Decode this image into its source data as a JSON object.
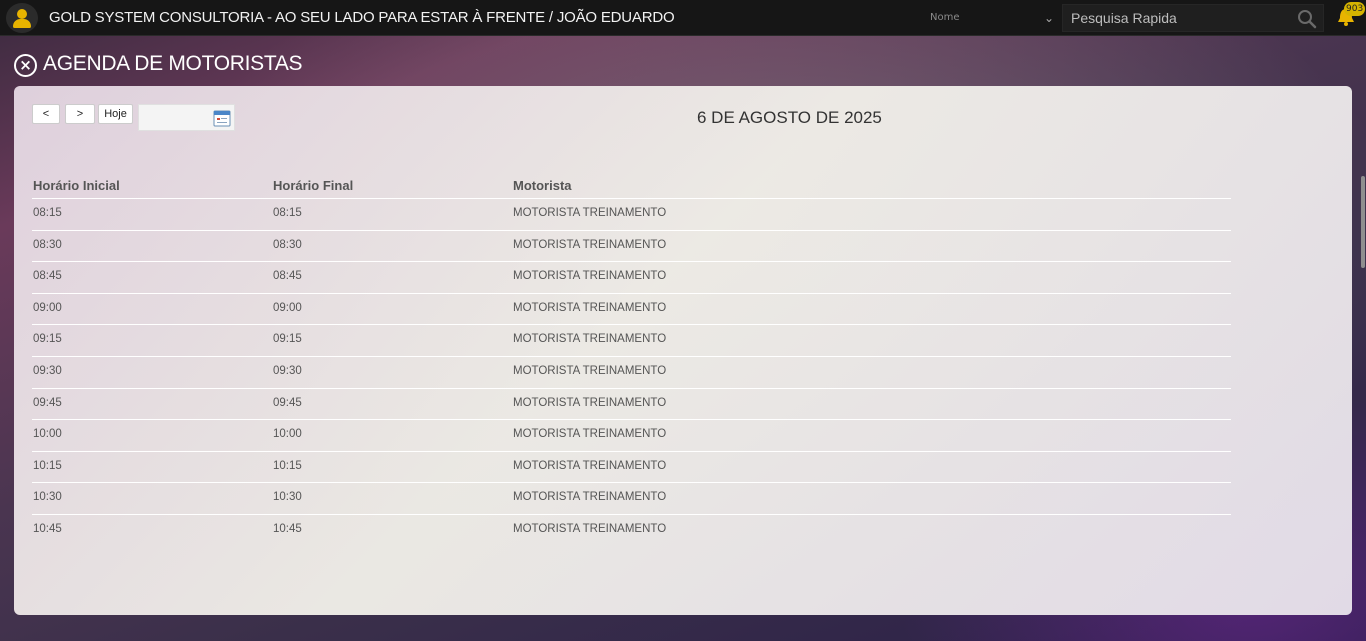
{
  "header": {
    "app_title": "GOLD SYSTEM CONSULTORIA - AO SEU LADO PARA ESTAR À FRENTE / JOÃO EDUARDO",
    "search_field_select": "Nome",
    "search_placeholder": "Pesquisa Rapida",
    "notification_count": "903"
  },
  "page": {
    "title": "AGENDA DE MOTORISTAS"
  },
  "toolbar": {
    "prev_label": "<",
    "next_label": ">",
    "today_label": "Hoje",
    "date_value": "",
    "date_heading": "6 DE AGOSTO DE 2025"
  },
  "table": {
    "columns": [
      "Horário Inicial",
      "Horário Final",
      "Motorista"
    ],
    "rows": [
      [
        "08:15",
        "08:15",
        "MOTORISTA TREINAMENTO"
      ],
      [
        "08:30",
        "08:30",
        "MOTORISTA TREINAMENTO"
      ],
      [
        "08:45",
        "08:45",
        "MOTORISTA TREINAMENTO"
      ],
      [
        "09:00",
        "09:00",
        "MOTORISTA TREINAMENTO"
      ],
      [
        "09:15",
        "09:15",
        "MOTORISTA TREINAMENTO"
      ],
      [
        "09:30",
        "09:30",
        "MOTORISTA TREINAMENTO"
      ],
      [
        "09:45",
        "09:45",
        "MOTORISTA TREINAMENTO"
      ],
      [
        "10:00",
        "10:00",
        "MOTORISTA TREINAMENTO"
      ],
      [
        "10:15",
        "10:15",
        "MOTORISTA TREINAMENTO"
      ],
      [
        "10:30",
        "10:30",
        "MOTORISTA TREINAMENTO"
      ],
      [
        "10:45",
        "10:45",
        "MOTORISTA TREINAMENTO"
      ]
    ]
  },
  "colors": {
    "accent": "#e8b400",
    "topbar": "#161616"
  }
}
